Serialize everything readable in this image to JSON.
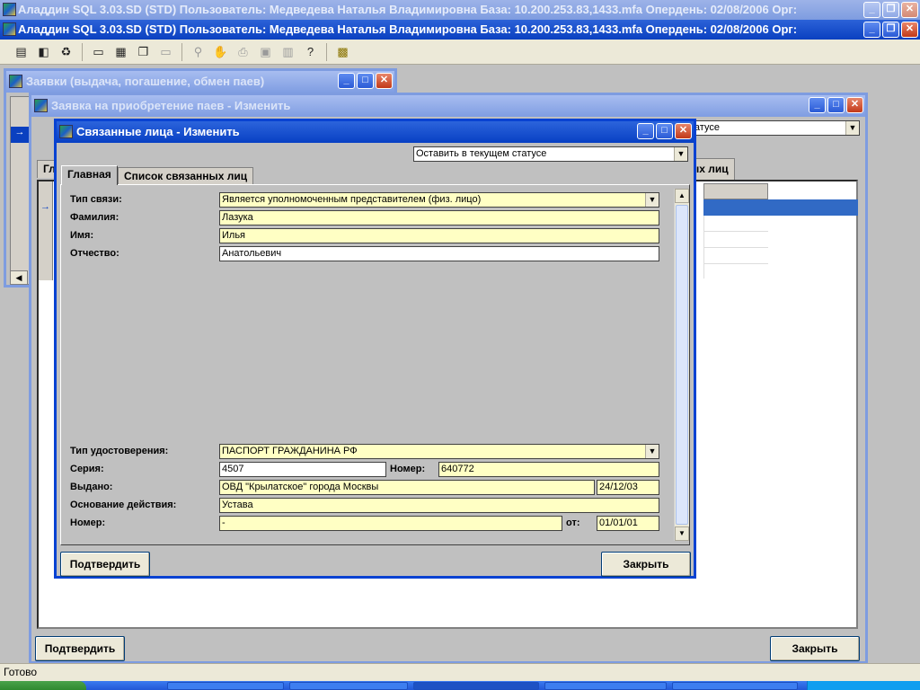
{
  "titlebars": {
    "inactive": "Аладдин SQL 3.03.SD (STD)  Пользователь: Медведева Наталья Владимировна База: 10.200.253.83,1433.mfa Опердень: 02/08/2006 Орг:",
    "active": "Аладдин SQL 3.03.SD (STD)  Пользователь: Медведева Наталья Владимировна База: 10.200.253.83,1433.mfa Опердень: 02/08/2006 Орг:"
  },
  "caption": {
    "minimize": "_",
    "maximize": "□",
    "restore": "❐",
    "close": "✕"
  },
  "toolbar": {
    "icons": [
      "list-icon",
      "bag-icon",
      "recycle-icon",
      "window-icon",
      "tile-icon",
      "cascade-icon",
      "window-disabled-icon",
      "binoculars-icon",
      "hand-icon",
      "printer-icon",
      "save-icon",
      "table-icon",
      "help-icon",
      "exit-icon"
    ]
  },
  "win_orders": {
    "title": "Заявки (выдача, погашение, обмен паев)",
    "tab_partial": "Сп",
    "arrow": "→"
  },
  "win_purchase": {
    "title": "Заявка на приобретение паев - Изменить",
    "status_partial": "татусе",
    "tab_main_partial": "Гл",
    "tab_related_partial": "ых лиц",
    "confirm": "Подтвердить",
    "close": "Закрыть"
  },
  "dialog": {
    "title": "Связанные лица - Изменить",
    "status_select": "Оставить в текущем статусе",
    "tabs": {
      "main": "Главная",
      "related": "Список связанных лиц"
    },
    "fields": {
      "link_type_label": "Тип связи:",
      "link_type_value": "Является уполномоченным представителем (физ. лицо)",
      "surname_label": "Фамилия:",
      "surname_value": "Лазука",
      "name_label": "Имя:",
      "name_value": "Илья",
      "patronymic_label": "Отчество:",
      "patronymic_value": "Анатольевич",
      "id_type_label": "Тип удостоверения:",
      "id_type_value": "ПАСПОРТ ГРАЖДАНИНА РФ",
      "series_label": "Серия:",
      "series_value": "4507",
      "number_label": "Номер:",
      "number_value": "640772",
      "issued_label": "Выдано:",
      "issued_value": "ОВД \"Крылатское\" города Москвы",
      "issued_date": "24/12/03",
      "basis_label": "Основание действия:",
      "basis_value": "Устава",
      "doc_number_label": "Номер:",
      "doc_number_value": "-",
      "from_label": "от:",
      "from_value": "01/01/01"
    },
    "confirm": "Подтвердить",
    "close": "Закрыть"
  },
  "statusbar": {
    "text": "Готово"
  },
  "colors": {
    "active_title": "#0a40c0",
    "field_bg": "#ffffc4",
    "selection": "#316ac5"
  }
}
